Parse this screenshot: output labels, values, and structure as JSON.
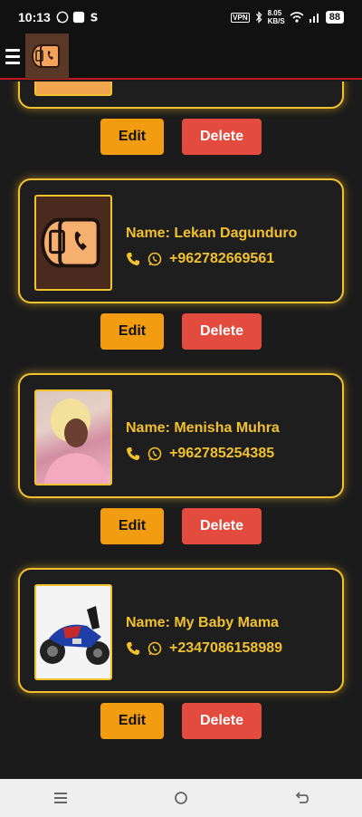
{
  "status": {
    "time": "10:13",
    "net_speed_top": "8.05",
    "net_speed_bottom": "KB/S",
    "battery": "88",
    "vpn": "VPN"
  },
  "actions": {
    "edit_label": "Edit",
    "delete_label": "Delete"
  },
  "contacts": [
    {
      "name": "Name: Lekan Dagunduro",
      "phone": "+962782669561"
    },
    {
      "name": "Name: Menisha Muhra",
      "phone": "+962785254385"
    },
    {
      "name": "Name: My Baby Mama",
      "phone": "+2347086158989"
    }
  ],
  "colors": {
    "accent": "#f2c12e",
    "edit": "#f29c11",
    "delete": "#e34b3e",
    "appbar_line": "#c4161c"
  },
  "icons": [
    "menu-icon",
    "phone-icon",
    "whatsapp-icon",
    "wifi-icon",
    "signal-icon",
    "bluetooth-icon"
  ]
}
